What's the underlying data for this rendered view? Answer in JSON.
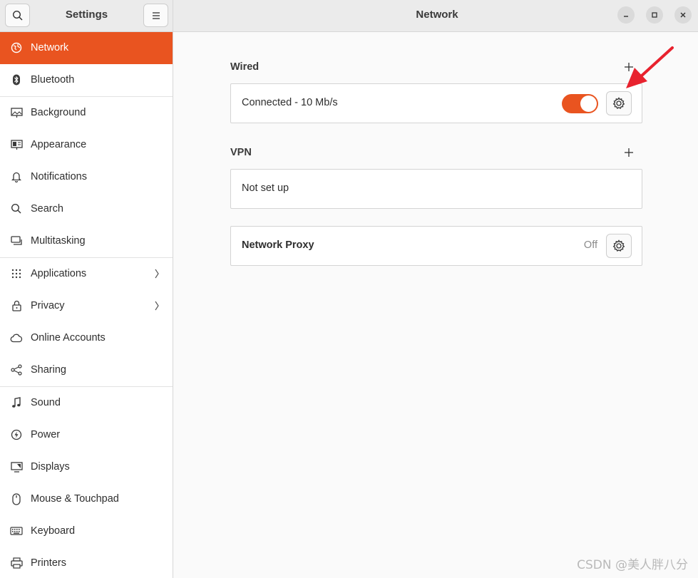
{
  "sidebar": {
    "title": "Settings",
    "items": [
      {
        "label": "Network",
        "icon": "network-icon"
      },
      {
        "label": "Bluetooth",
        "icon": "bluetooth-icon"
      },
      {
        "label": "Background",
        "icon": "background-icon"
      },
      {
        "label": "Appearance",
        "icon": "appearance-icon"
      },
      {
        "label": "Notifications",
        "icon": "bell-icon"
      },
      {
        "label": "Search",
        "icon": "search-icon"
      },
      {
        "label": "Multitasking",
        "icon": "multitasking-icon"
      },
      {
        "label": "Applications",
        "icon": "grid-icon"
      },
      {
        "label": "Privacy",
        "icon": "lock-icon"
      },
      {
        "label": "Online Accounts",
        "icon": "cloud-icon"
      },
      {
        "label": "Sharing",
        "icon": "share-icon"
      },
      {
        "label": "Sound",
        "icon": "music-note-icon"
      },
      {
        "label": "Power",
        "icon": "power-icon"
      },
      {
        "label": "Displays",
        "icon": "display-icon"
      },
      {
        "label": "Mouse & Touchpad",
        "icon": "mouse-icon"
      },
      {
        "label": "Keyboard",
        "icon": "keyboard-icon"
      },
      {
        "label": "Printers",
        "icon": "printer-icon"
      }
    ]
  },
  "main": {
    "title": "Network",
    "wired": {
      "title": "Wired",
      "status": "Connected - 10 Mb/s",
      "toggle_on": true
    },
    "vpn": {
      "title": "VPN",
      "status": "Not set up"
    },
    "proxy": {
      "label": "Network Proxy",
      "value": "Off"
    }
  },
  "watermark": "CSDN @美人胖八分",
  "colors": {
    "accent": "#e95420",
    "annotation_arrow": "#e8222e"
  }
}
